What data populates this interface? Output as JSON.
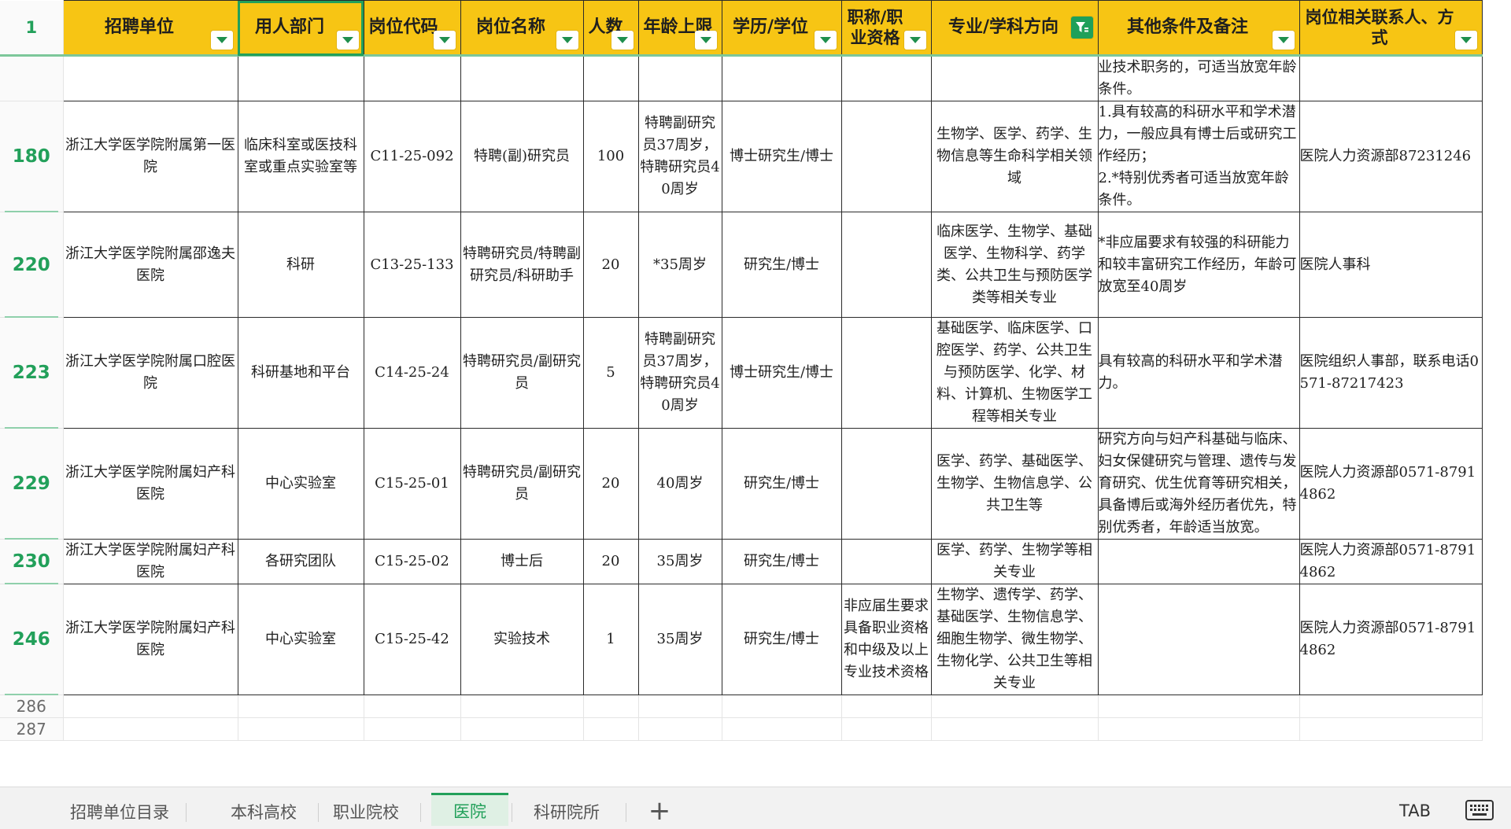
{
  "header": {
    "row_number": "1",
    "columns": [
      {
        "label": "招聘单位",
        "wrap": false
      },
      {
        "label": "用人部门",
        "wrap": false,
        "selected": true
      },
      {
        "label": "岗位代码",
        "wrap": false
      },
      {
        "label": "岗位名称",
        "wrap": false
      },
      {
        "label": "人数",
        "wrap": false
      },
      {
        "label": "年龄上限",
        "wrap": false
      },
      {
        "label": "学历/学位",
        "wrap": false
      },
      {
        "label": "职称/职业资格",
        "wrap": true
      },
      {
        "label": "专业/学科方向",
        "wrap": false,
        "filter_active": true
      },
      {
        "label": "其他条件及备注",
        "wrap": false
      },
      {
        "label": "岗位相关联系人、方式",
        "wrap": true
      }
    ]
  },
  "rows": [
    {
      "row_number": "",
      "cells": [
        "",
        "",
        "",
        "",
        "",
        "",
        "",
        "",
        "",
        "业技术职务的，可适当放宽年龄条件。",
        ""
      ]
    },
    {
      "row_number": "180",
      "cells": [
        "浙江大学医学院附属第一医院",
        "临床科室或医技科室或重点实验室等",
        "C11-25-092",
        "特聘(副)研究员",
        "100",
        "特聘副研究员37周岁，特聘研究员40周岁",
        "博士研究生/博士",
        "",
        "生物学、医学、药学、生物信息等生命科学相关领域",
        "1.具有较高的科研水平和学术潜力，一般应具有博士后或研究工作经历；\n2.*特别优秀者可适当放宽年龄条件。",
        "医院人力资源部87231246"
      ]
    },
    {
      "row_number": "220",
      "cells": [
        "浙江大学医学院附属邵逸夫医院",
        "科研",
        "C13-25-133",
        "特聘研究员/特聘副研究员/科研助手",
        "20",
        "*35周岁",
        "研究生/博士",
        "",
        "临床医学、生物学、基础医学、生物科学、药学类、公共卫生与预防医学类等相关专业",
        "*非应届要求有较强的科研能力和较丰富研究工作经历，年龄可放宽至40周岁",
        "医院人事科"
      ]
    },
    {
      "row_number": "223",
      "cells": [
        "浙江大学医学院附属口腔医院",
        "科研基地和平台",
        "C14-25-24",
        "特聘研究员/副研究员",
        "5",
        "特聘副研究员37周岁，特聘研究员40周岁",
        "博士研究生/博士",
        "",
        "基础医学、临床医学、口腔医学、药学、公共卫生与预防医学、化学、材料、计算机、生物医学工程等相关专业",
        "具有较高的科研水平和学术潜力。",
        "医院组织人事部，联系电话0571-87217423"
      ]
    },
    {
      "row_number": "229",
      "cells": [
        "浙江大学医学院附属妇产科医院",
        "中心实验室",
        "C15-25-01",
        "特聘研究员/副研究员",
        "20",
        "40周岁",
        "研究生/博士",
        "",
        "医学、药学、基础医学、生物学、生物信息学、公共卫生等",
        "研究方向与妇产科基础与临床、妇女保健研究与管理、遗传与发育研究、优生优育等研究相关，具备博后或海外经历者优先，特别优秀者，年龄适当放宽。",
        "医院人力资源部0571-87914862"
      ]
    },
    {
      "row_number": "230",
      "cells": [
        "浙江大学医学院附属妇产科医院",
        "各研究团队",
        "C15-25-02",
        "博士后",
        "20",
        "35周岁",
        "研究生/博士",
        "",
        "医学、药学、生物学等相关专业",
        "",
        "医院人力资源部0571-87914862"
      ]
    },
    {
      "row_number": "246",
      "cells": [
        "浙江大学医学院附属妇产科医院",
        "中心实验室",
        "C15-25-42",
        "实验技术",
        "1",
        "35周岁",
        "研究生/博士",
        "非应届生要求具备职业资格和中级及以上专业技术资格",
        "生物学、遗传学、药学、基础医学、生物信息学、细胞生物学、微生物学、生物化学、公共卫生等相关专业",
        "",
        "医院人力资源部0571-87914862"
      ]
    }
  ],
  "empty_rows": [
    "286",
    "287"
  ],
  "tabs": [
    {
      "label": "招聘单位目录",
      "active": false
    },
    {
      "label": "本科高校",
      "active": false
    },
    {
      "label": "职业院校",
      "active": false
    },
    {
      "label": "医院",
      "active": true
    },
    {
      "label": "科研院所",
      "active": false
    }
  ],
  "add_sheet_symbol": "+",
  "tab_key_label": "TAB",
  "icons": {
    "filter_dropdown": "triangle-down-icon",
    "filter_active": "funnel-icon",
    "add_sheet": "plus-icon",
    "keyboard": "keyboard-icon"
  },
  "colors": {
    "header_bg": "#f7c514",
    "accent_green": "#22a05a",
    "grid_line": "#2b2b2b",
    "active_tab_bg": "#dff0e4"
  }
}
